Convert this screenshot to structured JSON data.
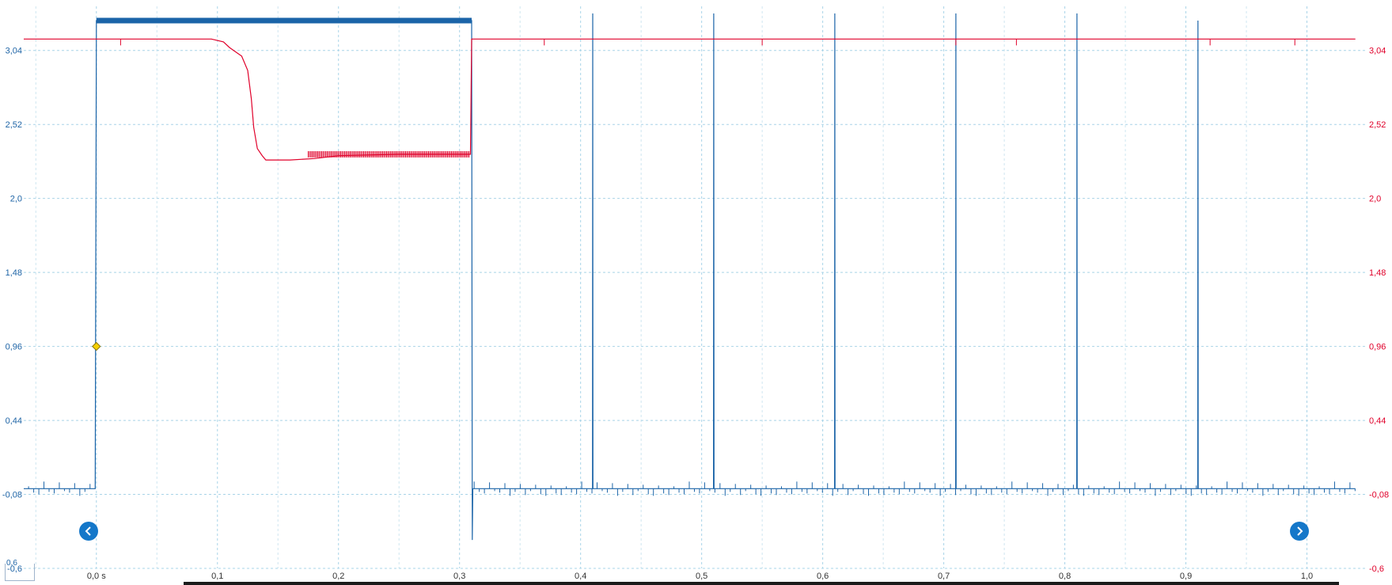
{
  "chart_data": {
    "type": "line",
    "title": "",
    "xlabel": "",
    "ylabel": "",
    "x_unit": "s",
    "xlim": [
      -0.06,
      1.05
    ],
    "x_ticks": [
      "0,0 s",
      "0,1",
      "0,2",
      "0,3",
      "0,4",
      "0,5",
      "0,6",
      "0,7",
      "0,8",
      "0,9",
      "1,0"
    ],
    "x_tick_values": [
      0.0,
      0.1,
      0.2,
      0.3,
      0.4,
      0.5,
      0.6,
      0.7,
      0.8,
      0.9,
      1.0
    ],
    "y_left": {
      "color": "#1e64a6",
      "ylim": [
        -0.6,
        3.35
      ],
      "ticks": [
        "3,04",
        "2,52",
        "2,0",
        "1,48",
        "0,96",
        "0,44",
        "-0,08",
        "-0,6"
      ],
      "tick_values": [
        3.04,
        2.52,
        2.0,
        1.48,
        0.96,
        0.44,
        -0.08,
        -0.6
      ]
    },
    "y_right": {
      "color": "#e0002a",
      "ylim": [
        -0.6,
        3.35
      ],
      "ticks": [
        "3,04",
        "2,52",
        "2,0",
        "1,48",
        "0,96",
        "0,44",
        "-0,08",
        "-0,6"
      ],
      "tick_values": [
        3.04,
        2.52,
        2.0,
        1.48,
        0.96,
        0.44,
        -0.08,
        -0.6
      ]
    },
    "grid": true,
    "trigger_marker": {
      "x": 0.0,
      "y": 0.96,
      "color": "#f5d000"
    },
    "series": [
      {
        "color": "#1b64a8",
        "axis": "left",
        "x": [
          -0.06,
          -0.001,
          0.0,
          0.001,
          0.31,
          0.3105,
          0.311,
          0.4098,
          0.41,
          0.4102,
          0.5098,
          0.51,
          0.5102,
          0.6098,
          0.61,
          0.6102,
          0.7098,
          0.71,
          0.7102,
          0.8098,
          0.81,
          0.8102,
          0.9098,
          0.91,
          0.9102,
          1.04
        ],
        "y": [
          -0.04,
          -0.04,
          3.25,
          3.25,
          3.25,
          -0.4,
          -0.04,
          -0.04,
          3.3,
          -0.04,
          -0.04,
          3.3,
          -0.04,
          -0.04,
          3.3,
          -0.04,
          -0.04,
          3.3,
          -0.04,
          -0.04,
          3.3,
          -0.04,
          -0.04,
          3.25,
          -0.04,
          -0.04
        ]
      },
      {
        "color": "#e0002a",
        "axis": "right",
        "x": [
          -0.06,
          0.095,
          0.105,
          0.11,
          0.115,
          0.12,
          0.125,
          0.128,
          0.13,
          0.133,
          0.137,
          0.14,
          0.16,
          0.18,
          0.2,
          0.25,
          0.3,
          0.309,
          0.31,
          1.04
        ],
        "y": [
          3.12,
          3.12,
          3.1,
          3.06,
          3.03,
          3.0,
          2.9,
          2.7,
          2.5,
          2.35,
          2.3,
          2.27,
          2.27,
          2.28,
          2.3,
          2.31,
          2.31,
          2.31,
          3.12,
          3.12
        ]
      }
    ]
  },
  "nav": {
    "prev_icon": "chevron-left-icon",
    "next_icon": "chevron-right-icon",
    "corner_label": "0,6"
  }
}
